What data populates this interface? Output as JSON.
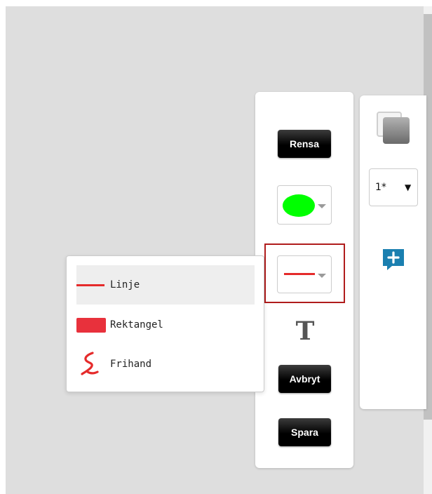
{
  "toolbar": {
    "clear_label": "Rensa",
    "cancel_label": "Avbryt",
    "save_label": "Spara",
    "text_tool_glyph": "T",
    "fill_color": "#00ff00",
    "stroke_color": "#e52b2b"
  },
  "shape_menu": {
    "items": [
      {
        "label": "Linje",
        "icon": "line-icon",
        "selected": true
      },
      {
        "label": "Rektangel",
        "icon": "rectangle-icon",
        "selected": false
      },
      {
        "label": "Frihand",
        "icon": "freehand-icon",
        "selected": false
      }
    ]
  },
  "side_panel": {
    "size_value": "1*",
    "size_arrow": "▼",
    "layers_icon": "layers-icon",
    "add_icon": "add-comment-icon",
    "accent_color": "#1a7fb0"
  }
}
